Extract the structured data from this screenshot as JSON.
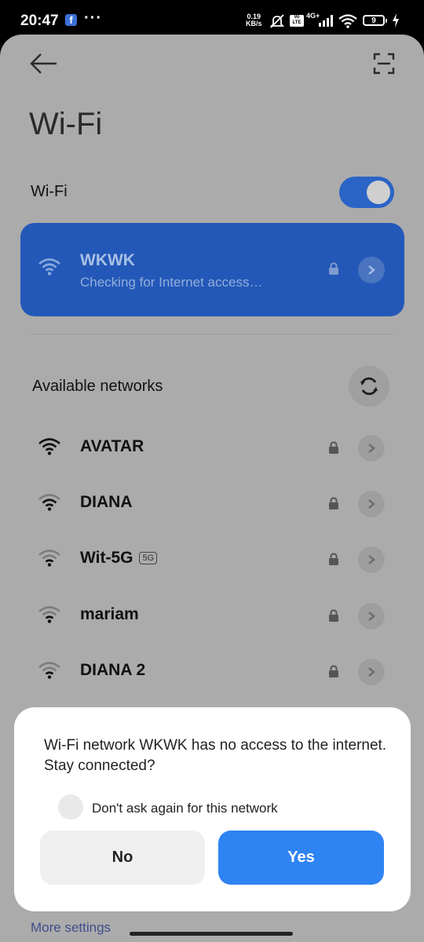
{
  "status_bar": {
    "time": "20:47",
    "facebook_glyph": "f",
    "more_dots": "···",
    "net_speed_value": "0.19",
    "net_speed_unit": "KB/s",
    "volte_badge": "Vo LTE",
    "signal_badge": "4G+",
    "battery_level": "9",
    "icons": [
      "facebook-notification-icon",
      "more-notifications-icon",
      "mute-icon",
      "volte-icon",
      "signal-icon",
      "wifi-icon",
      "battery-icon",
      "charging-icon"
    ]
  },
  "header": {
    "title": "Wi-Fi",
    "icons": [
      "back-arrow-icon",
      "qr-scan-icon"
    ]
  },
  "wifi_toggle": {
    "label": "Wi-Fi",
    "state": "on"
  },
  "connected_network": {
    "name": "WKWK",
    "status": "Checking for Internet access…"
  },
  "available": {
    "label": "Available networks",
    "networks": [
      {
        "name": "AVATAR",
        "badge": "",
        "signal": 4
      },
      {
        "name": "DIANA",
        "badge": "",
        "signal": 3
      },
      {
        "name": "Wit-5G",
        "badge": "5G",
        "signal": 2
      },
      {
        "name": "mariam",
        "badge": "",
        "signal": 2
      },
      {
        "name": "DIANA 2",
        "badge": "",
        "signal": 2
      }
    ]
  },
  "more_settings": "More settings",
  "dialog": {
    "message": "Wi-Fi network WKWK has no access to the internet. Stay connected?",
    "checkbox_label": "Don't ask again for this network",
    "no_label": "No",
    "yes_label": "Yes"
  },
  "colors": {
    "accent": "#2f84f3",
    "connected_card": "#2458b8",
    "scrim_background": "#ababab"
  }
}
